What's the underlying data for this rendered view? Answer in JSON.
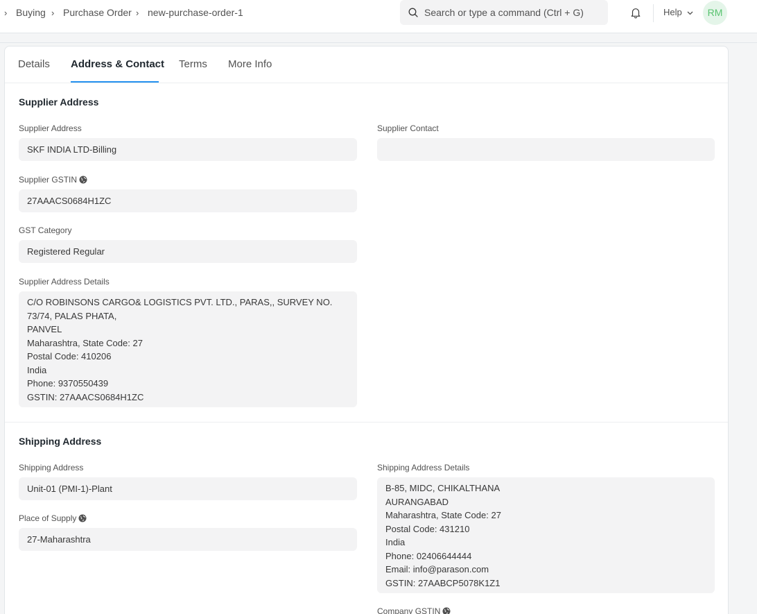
{
  "navbar": {
    "breadcrumbs": [
      "Buying",
      "Purchase Order",
      "new-purchase-order-1"
    ],
    "search_placeholder": "Search or type a command (Ctrl + G)",
    "help_label": "Help",
    "avatar_initials": "RM"
  },
  "tabs": [
    "Details",
    "Address & Contact",
    "Terms",
    "More Info"
  ],
  "active_tab": "Address & Contact",
  "supplier_section": {
    "title": "Supplier Address",
    "supplier_address_label": "Supplier Address",
    "supplier_address_value": "SKF INDIA LTD-Billing",
    "supplier_contact_label": "Supplier Contact",
    "supplier_contact_value": "",
    "supplier_gstin_label": "Supplier GSTIN",
    "supplier_gstin_value": "27AAACS0684H1ZC",
    "gst_category_label": "GST Category",
    "gst_category_value": "Registered Regular",
    "address_details_label": "Supplier Address Details",
    "address_details_value": "C/O ROBINSONS CARGO& LOGISTICS PVT. LTD., PARAS,, SURVEY NO.\n73/74, PALAS PHATA,\nPANVEL\nMaharashtra, State Code: 27\nPostal Code: 410206\nIndia\nPhone: 9370550439\nGSTIN: 27AAACS0684H1ZC"
  },
  "shipping_section": {
    "title": "Shipping Address",
    "shipping_address_label": "Shipping Address",
    "shipping_address_value": "Unit-01 (PMI-1)-Plant",
    "place_of_supply_label": "Place of Supply",
    "place_of_supply_value": "27-Maharashtra",
    "shipping_details_label": "Shipping Address Details",
    "shipping_details_value": "B-85, MIDC, CHIKALTHANA\nAURANGABAD\nMaharashtra, State Code: 27\nPostal Code: 431210\nIndia\nPhone: 02406644444\nEmail: info@parason.com\nGSTIN: 27AABCP5078K1Z1",
    "company_gstin_label": "Company GSTIN"
  },
  "colors": {
    "accent": "#2490ef",
    "field_bg": "#f3f3f4",
    "avatar_bg": "#e4f5e9",
    "avatar_text": "#58c36f"
  }
}
